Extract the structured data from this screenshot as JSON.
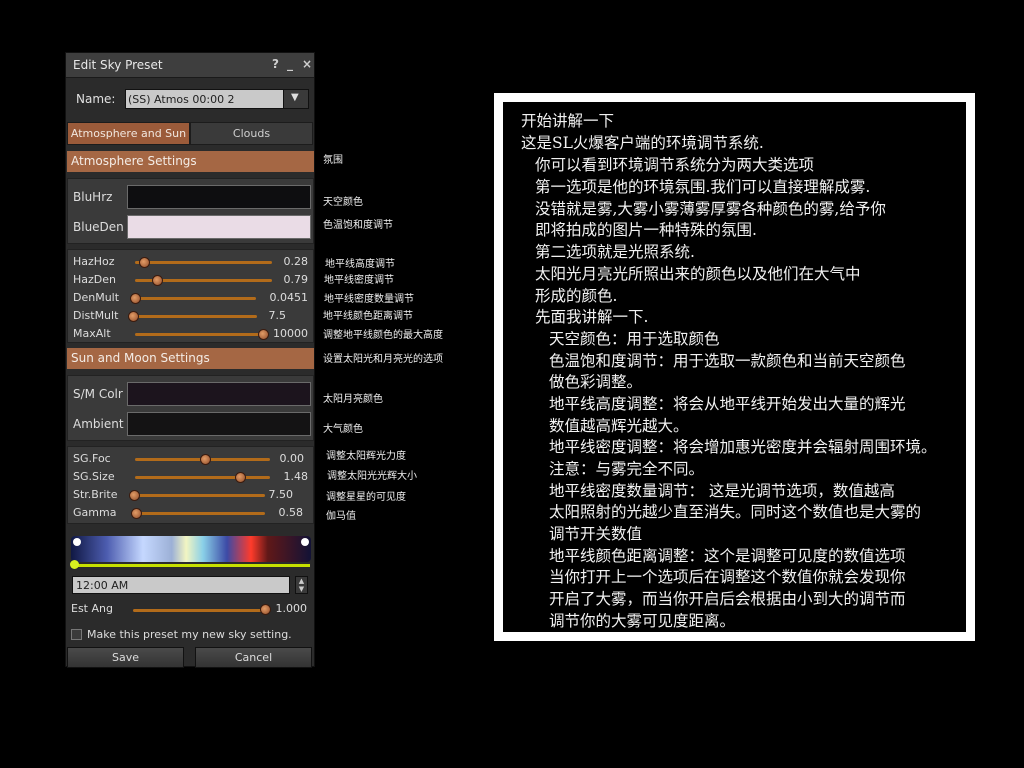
{
  "window": {
    "title": "Edit Sky Preset",
    "help": "?",
    "minimize": "_",
    "close": "×"
  },
  "name_field": {
    "label": "Name:",
    "value": "(SS) Atmos 00:00 2",
    "arrow": "▼"
  },
  "tabs": [
    {
      "label": "Atmosphere and Sun",
      "active": true
    },
    {
      "label": "Clouds",
      "active": false
    }
  ],
  "atmosphere": {
    "header": "Atmosphere Settings",
    "bluhrz_label": "BluHrz",
    "blueden_label": "BlueDen",
    "bluhrz_color": "#0e0e10",
    "blueden_color": "#eadce6",
    "sliders": [
      {
        "label": "HazHoz",
        "value": "0.28",
        "level": 0.03
      },
      {
        "label": "HazDen",
        "value": "0.79",
        "level": 0.13
      },
      {
        "label": "DenMult",
        "value": "0.0451",
        "level": 0.0
      },
      {
        "label": "DistMult",
        "value": "7.5",
        "level": 0.0
      },
      {
        "label": "MaxAlt",
        "value": "10000",
        "level": 1.0
      }
    ]
  },
  "sun_moon": {
    "header": "Sun and Moon Settings",
    "smcolr_label": "S/M Colr",
    "ambient_label": "Ambient",
    "smcolr_color": "#1c141d",
    "ambient_color": "#141314",
    "sliders": [
      {
        "label": "SG.Foc",
        "value": "0.00",
        "level": 0.5
      },
      {
        "label": "SG.Size",
        "value": "1.48",
        "level": 0.77
      },
      {
        "label": "Str.Brite",
        "value": "7.50",
        "level": 0.0
      },
      {
        "label": "Gamma",
        "value": "0.58",
        "level": 0.0
      }
    ]
  },
  "time": {
    "value": "12:00 AM",
    "spin_up": "▲",
    "spin_down": "▼"
  },
  "est_ang": {
    "label": "Est Ang",
    "value": "1.000",
    "level": 1.0
  },
  "checkbox": {
    "label": "Make this preset my new sky setting.",
    "checked": false
  },
  "buttons": {
    "save": "Save",
    "cancel": "Cancel"
  },
  "annotations": {
    "atmosphere": "氛围",
    "bluhrz": "天空颜色",
    "blueden": "色温饱和度调节",
    "hazhoz": "地平线高度调节",
    "hazden": "地平线密度调节",
    "denmult": "地平线密度数量调节",
    "distmult": "地平线颜色距离调节",
    "maxalt": "调整地平线颜色的最大高度",
    "sunmoon": "设置太阳光和月亮光的选项",
    "smcolr": "太阳月亮颜色",
    "ambient": "大气颜色",
    "sgfoc": "调整太阳辉光力度",
    "sgsize": "调整太阳光光辉大小",
    "strbrite": "调整星星的可见度",
    "gamma": "伽马值"
  },
  "notes": [
    "开始讲解一下",
    "这是SL火爆客户端的环境调节系统.",
    "你可以看到环境调节系统分为两大类选项",
    "第一选项是他的环境氛围.我们可以直接理解成雾.",
    "没错就是雾,大雾小雾薄雾厚雾各种颜色的雾,给予你",
    "即将拍成的图片一种特殊的氛围.",
    "第二选项就是光照系统.",
    "太阳光月亮光所照出来的颜色以及他们在大气中",
    "形成的颜色.",
    "先面我讲解一下.",
    "天空颜色：用于选取颜色",
    "色温饱和度调节：用于选取一款颜色和当前天空颜色",
    "做色彩调整。",
    "地平线高度调整：将会从地平线开始发出大量的辉光",
    "数值越高辉光越大。",
    "地平线密度调整：将会增加惠光密度并会辐射周围环境。",
    "注意：与雾完全不同。",
    "地平线密度数量调节：  这是光调节选项，数值越高",
    "太阳照射的光越少直至消失。同时这个数值也是大雾的",
    "调节开关数值",
    "地平线颜色距离调整：这个是调整可见度的数值选项",
    "当你打开上一个选项后在调整这个数值你就会发现你",
    "开启了大雾，而当你开启后会根据由小到大的调节而",
    "调节你的大雾可见度距离。"
  ]
}
